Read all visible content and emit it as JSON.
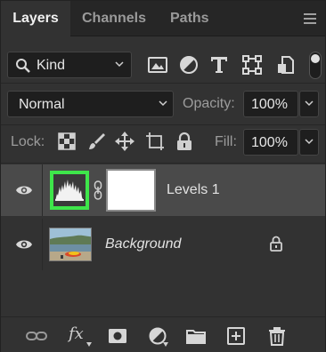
{
  "tabs": [
    {
      "label": "Layers",
      "active": true
    },
    {
      "label": "Channels",
      "active": false
    },
    {
      "label": "Paths",
      "active": false
    }
  ],
  "filter": {
    "kind_label": "Kind",
    "icons": [
      "image-filter-icon",
      "adjustment-filter-icon",
      "type-filter-icon",
      "shape-filter-icon",
      "smart-object-filter-icon"
    ],
    "filter_toggle_on": true
  },
  "blend": {
    "mode": "Normal",
    "opacity_label": "Opacity:",
    "opacity_value": "100%"
  },
  "lock": {
    "label": "Lock:",
    "icons": [
      "lock-transparency-icon",
      "lock-image-pixels-icon",
      "lock-position-icon",
      "prevent-auto-nesting-icon",
      "lock-all-icon"
    ],
    "fill_label": "Fill:",
    "fill_value": "100%"
  },
  "layers": [
    {
      "name": "Levels 1",
      "type": "adjustment",
      "visible": true,
      "selected": true,
      "italic": false,
      "locked": false
    },
    {
      "name": "Background",
      "type": "image",
      "visible": true,
      "selected": false,
      "italic": true,
      "locked": true
    }
  ],
  "bottom_icons": [
    "link-layers-icon",
    "fx-icon",
    "add-mask-icon",
    "new-adjustment-icon",
    "new-group-icon",
    "new-layer-icon",
    "delete-layer-icon"
  ],
  "bottom": {
    "fx_text": "fx"
  },
  "colors": {
    "panel_bg": "#323232",
    "selected_layer_bg": "#4a4a4a",
    "thumbnail_highlight": "#3ee64a"
  }
}
